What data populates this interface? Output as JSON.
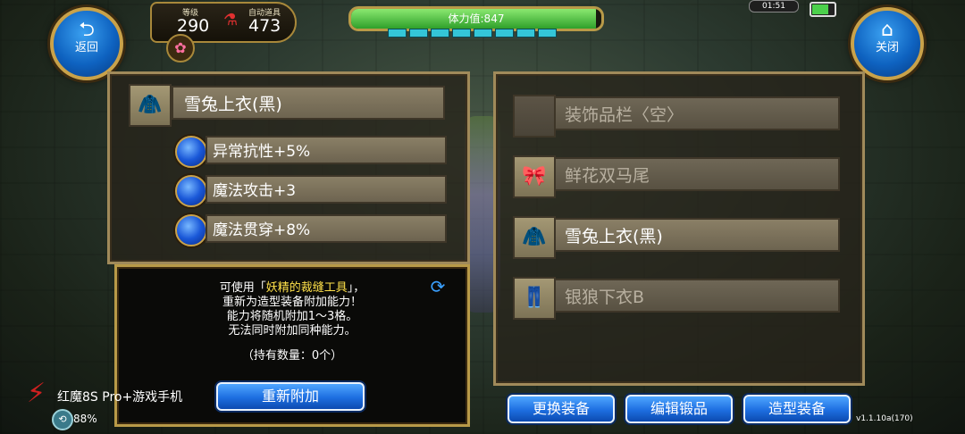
{
  "topbar": {
    "back_label": "返回",
    "close_label": "关闭",
    "level_label": "等级",
    "level_value": "290",
    "potion_label": "自动道具",
    "potion_value": "473",
    "stamina_text": "体力值:847",
    "stamina_fill": 0.98,
    "clock": "01:51"
  },
  "left_panel": {
    "item_name": "雪兔上衣(黑)",
    "attributes": [
      "异常抗性+5%",
      "魔法攻击+3",
      "魔法贯穿+8%"
    ]
  },
  "info": {
    "line1_prefix": "可使用「",
    "line1_highlight": "妖精的裁缝工具",
    "line1_suffix": "」，",
    "line2": "重新为造型装备附加能力！",
    "line3": "能力将随机附加1～3格。",
    "line4": "无法同时附加同种能力。",
    "line5": "（持有数量：0个）",
    "reattach_button": "重新附加"
  },
  "right_panel": {
    "slots": [
      {
        "label": "装饰品栏〈空〉",
        "icon": "empty-slot-icon",
        "dim": true
      },
      {
        "label": "鲜花双马尾",
        "icon": "flower-bow-icon",
        "dim": true
      },
      {
        "label": "雪兔上衣(黑)",
        "icon": "jacket-icon",
        "dim": false
      },
      {
        "label": "银狼下衣B",
        "icon": "pants-icon",
        "dim": true
      }
    ],
    "buttons": [
      "更换装备",
      "编辑锻品",
      "造型装备"
    ]
  },
  "footer": {
    "brand": "红魔8S Pro+游戏手机",
    "battery_pct": "88%",
    "version": "v1.1.10a(170)"
  }
}
